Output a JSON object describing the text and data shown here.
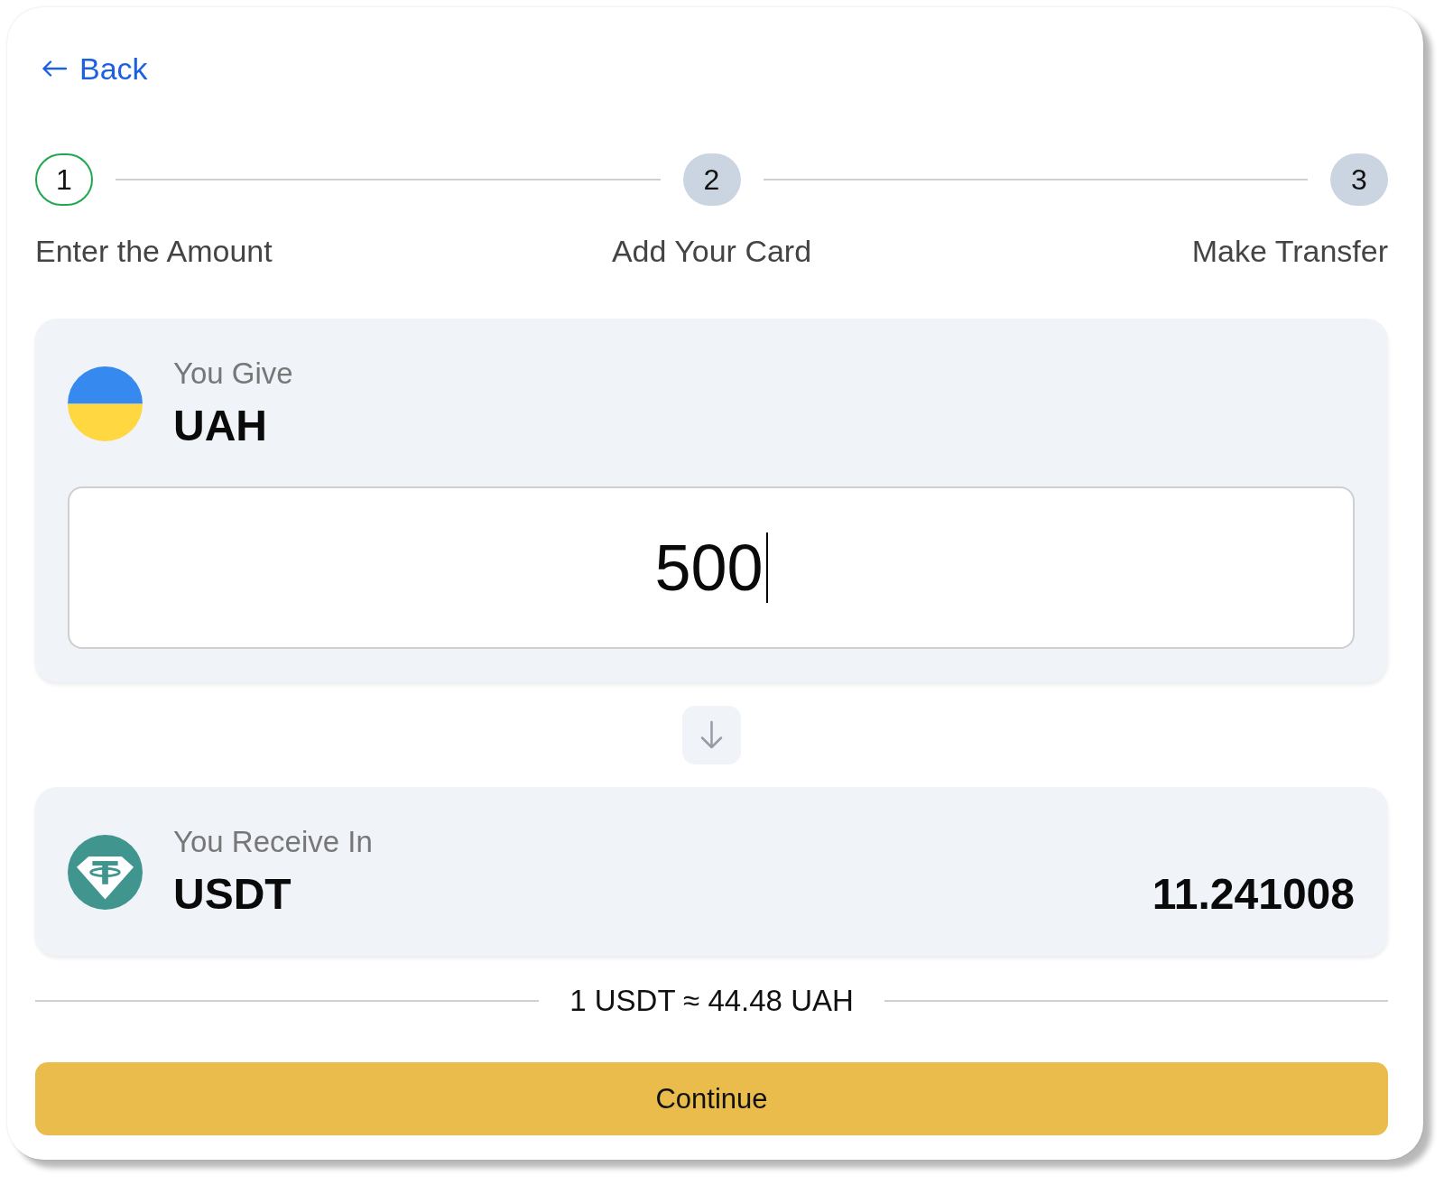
{
  "back": {
    "label": "Back"
  },
  "steps": [
    {
      "number": "1",
      "label": "Enter the Amount",
      "selected": true
    },
    {
      "number": "2",
      "label": "Add Your Card",
      "selected": false
    },
    {
      "number": "3",
      "label": "Make Transfer",
      "selected": false
    }
  ],
  "give": {
    "label": "You Give",
    "currency": "UAH",
    "amount": "500",
    "focused": true
  },
  "receive": {
    "label": "You Receive In",
    "currency": "USDT",
    "amount": "11.241008"
  },
  "rate": "1 USDT ≈ 44.48 UAH",
  "continue_button": {
    "label": "Continue"
  }
}
